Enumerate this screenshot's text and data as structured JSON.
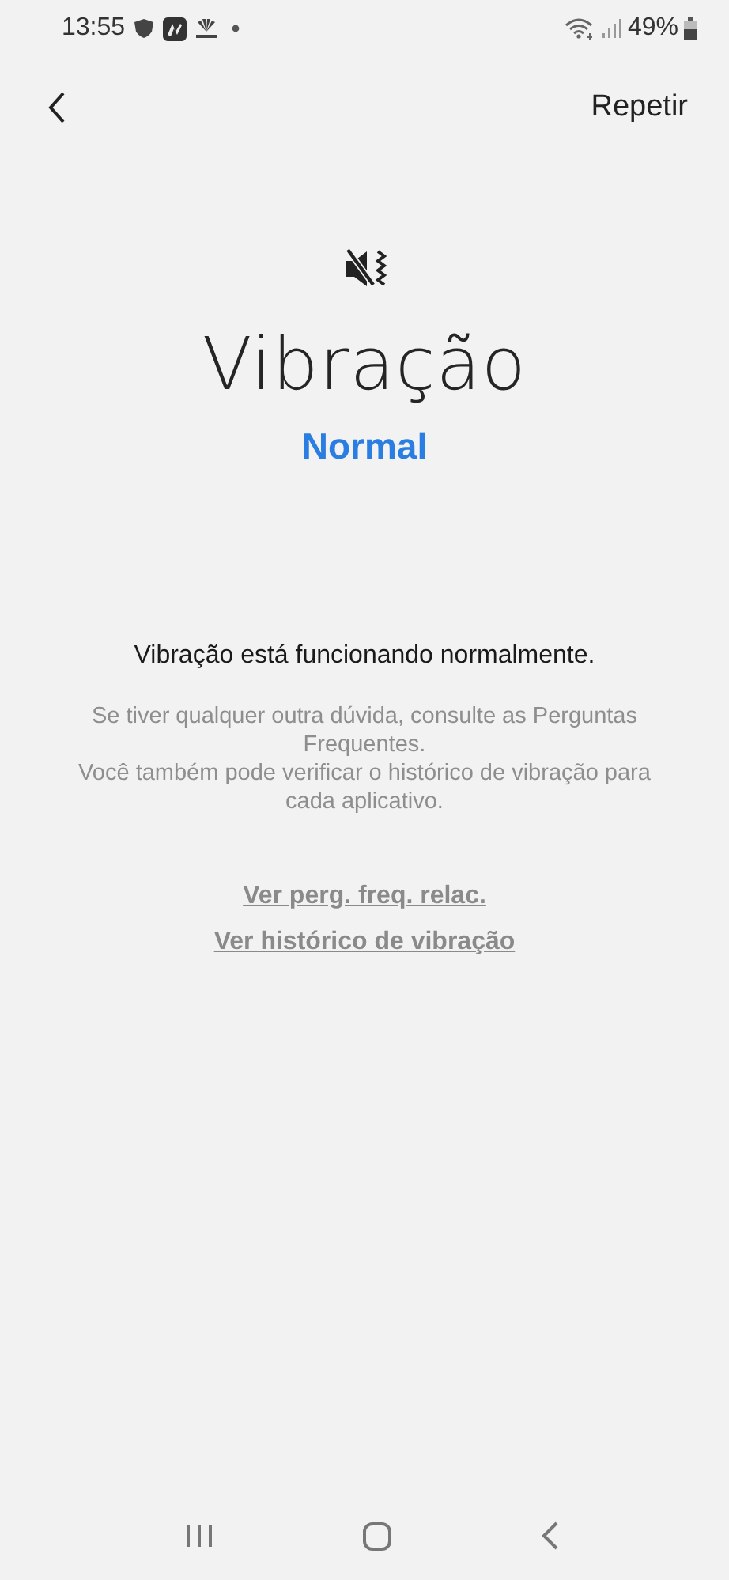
{
  "status_bar": {
    "time": "13:55",
    "battery": "49%"
  },
  "header": {
    "action": "Repetir"
  },
  "title": "Vibração",
  "status": "Normal",
  "message": "Vibração está funcionando normalmente.",
  "descriptions": [
    "Se tiver qualquer outra dúvida, consulte as Perguntas Frequentes.",
    "Você também pode verificar o histórico de vibração para cada aplicativo."
  ],
  "links": [
    "Ver perg. freq. relac.",
    "Ver histórico de vibração"
  ]
}
